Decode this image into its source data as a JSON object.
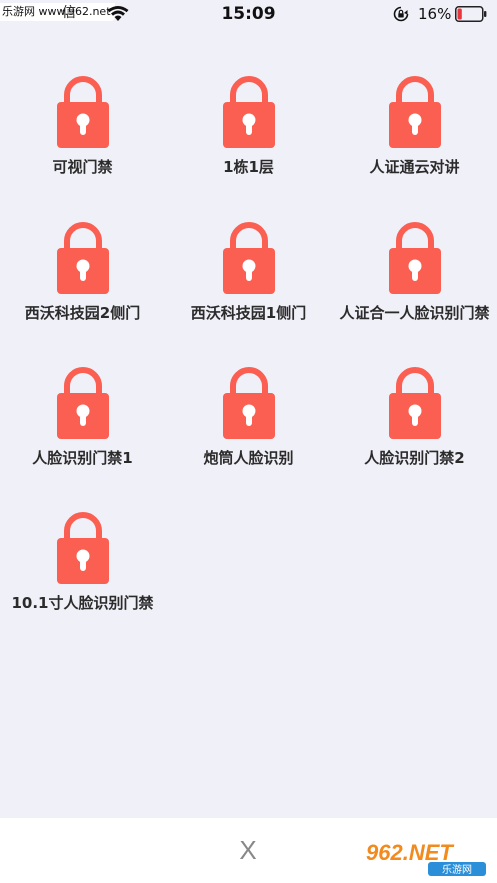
{
  "status_bar": {
    "watermark": "乐游网 www.962.net",
    "carrier_tail": "信",
    "time": "15:09",
    "battery_percent": "16%",
    "battery_level": 0.16
  },
  "colors": {
    "lock": "#fa5f52",
    "background": "#f0f0f8"
  },
  "tiles": [
    {
      "label": "可视门禁",
      "icon": "lock-icon"
    },
    {
      "label": "1栋1层",
      "icon": "lock-icon"
    },
    {
      "label": "人证通云对讲",
      "icon": "lock-icon"
    },
    {
      "label": "西沃科技园2侧门",
      "icon": "lock-icon"
    },
    {
      "label": "西沃科技园1侧门",
      "icon": "lock-icon"
    },
    {
      "label": "人证合一人脸识别门禁",
      "icon": "lock-icon"
    },
    {
      "label": "人脸识别门禁1",
      "icon": "lock-icon"
    },
    {
      "label": "炮筒人脸识别",
      "icon": "lock-icon"
    },
    {
      "label": "人脸识别门禁2",
      "icon": "lock-icon"
    },
    {
      "label": "10.1寸人脸识别门禁",
      "icon": "lock-icon"
    }
  ],
  "bottom_bar": {
    "close_label": "X"
  },
  "brand": {
    "logo_text": "962.NET",
    "sub_text": "乐游网"
  }
}
